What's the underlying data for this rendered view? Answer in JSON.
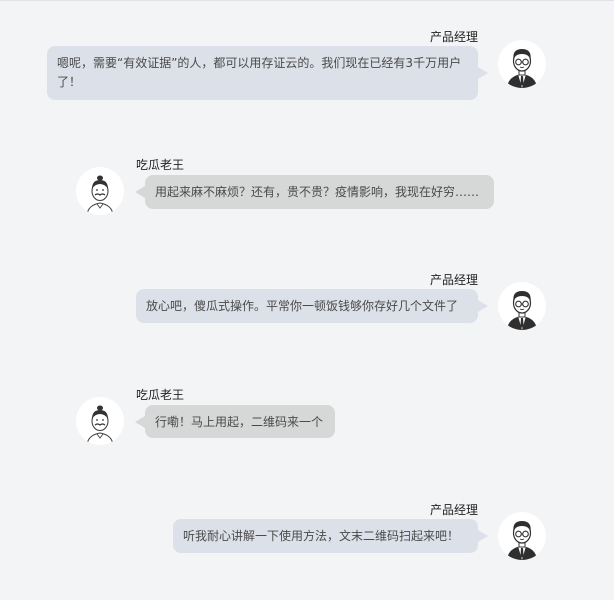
{
  "messages": [
    {
      "speaker": "产品经理",
      "text": "嗯呢，需要“有效证据”的人，都可以用存证云的。我们现在已经有3千万用户了！"
    },
    {
      "speaker": "吃瓜老王",
      "text": "用起来麻不麻烦？还有，贵不贵？疫情影响，我现在好穷……"
    },
    {
      "speaker": "产品经理",
      "text": "放心吧，傻瓜式操作。平常你一顿饭钱够你存好几个文件了"
    },
    {
      "speaker": "吃瓜老王",
      "text": "行嘞！马上用起，二维码来一个"
    },
    {
      "speaker": "产品经理",
      "text": "听我耐心讲解一下使用方法，文末二维码扫起来吧！"
    }
  ],
  "avatars": {
    "product_manager_icon": "businessman-with-glasses-icon",
    "wang_icon": "mustached-man-icon"
  },
  "colors": {
    "background": "#f3f4f6",
    "pm_bubble": "#dce0e9",
    "wang_bubble": "#d5d8d7",
    "text": "#4a4a4a"
  }
}
